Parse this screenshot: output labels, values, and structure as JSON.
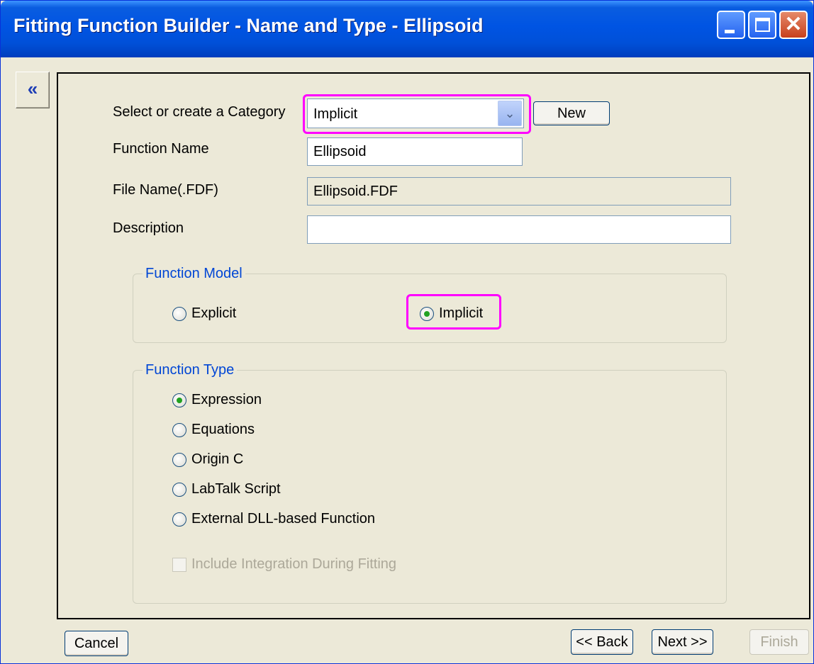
{
  "window": {
    "title": "Fitting Function Builder - Name and Type - Ellipsoid"
  },
  "nav": {
    "collapse_glyph": "«"
  },
  "form": {
    "category_label": "Select or create a Category",
    "category_value": "Implicit",
    "new_button": "New",
    "function_name_label": "Function Name",
    "function_name_value": "Ellipsoid",
    "file_name_label": "File Name(.FDF)",
    "file_name_value": "Ellipsoid.FDF",
    "description_label": "Description",
    "description_value": ""
  },
  "function_model": {
    "title": "Function Model",
    "options": [
      "Explicit",
      "Implicit"
    ],
    "selected": "Implicit"
  },
  "function_type": {
    "title": "Function Type",
    "options": [
      "Expression",
      "Equations",
      "Origin C",
      "LabTalk Script",
      "External DLL-based Function"
    ],
    "selected": "Expression",
    "include_integration_label": "Include Integration During Fitting",
    "include_integration_checked": false,
    "include_integration_enabled": false
  },
  "footer": {
    "cancel": "Cancel",
    "back": "<< Back",
    "next": "Next >>",
    "finish": "Finish"
  },
  "colors": {
    "highlight": "#ff00ff",
    "group_title": "#0046d5",
    "title_bar": "#0054e3",
    "radio_dot": "#21a121"
  }
}
